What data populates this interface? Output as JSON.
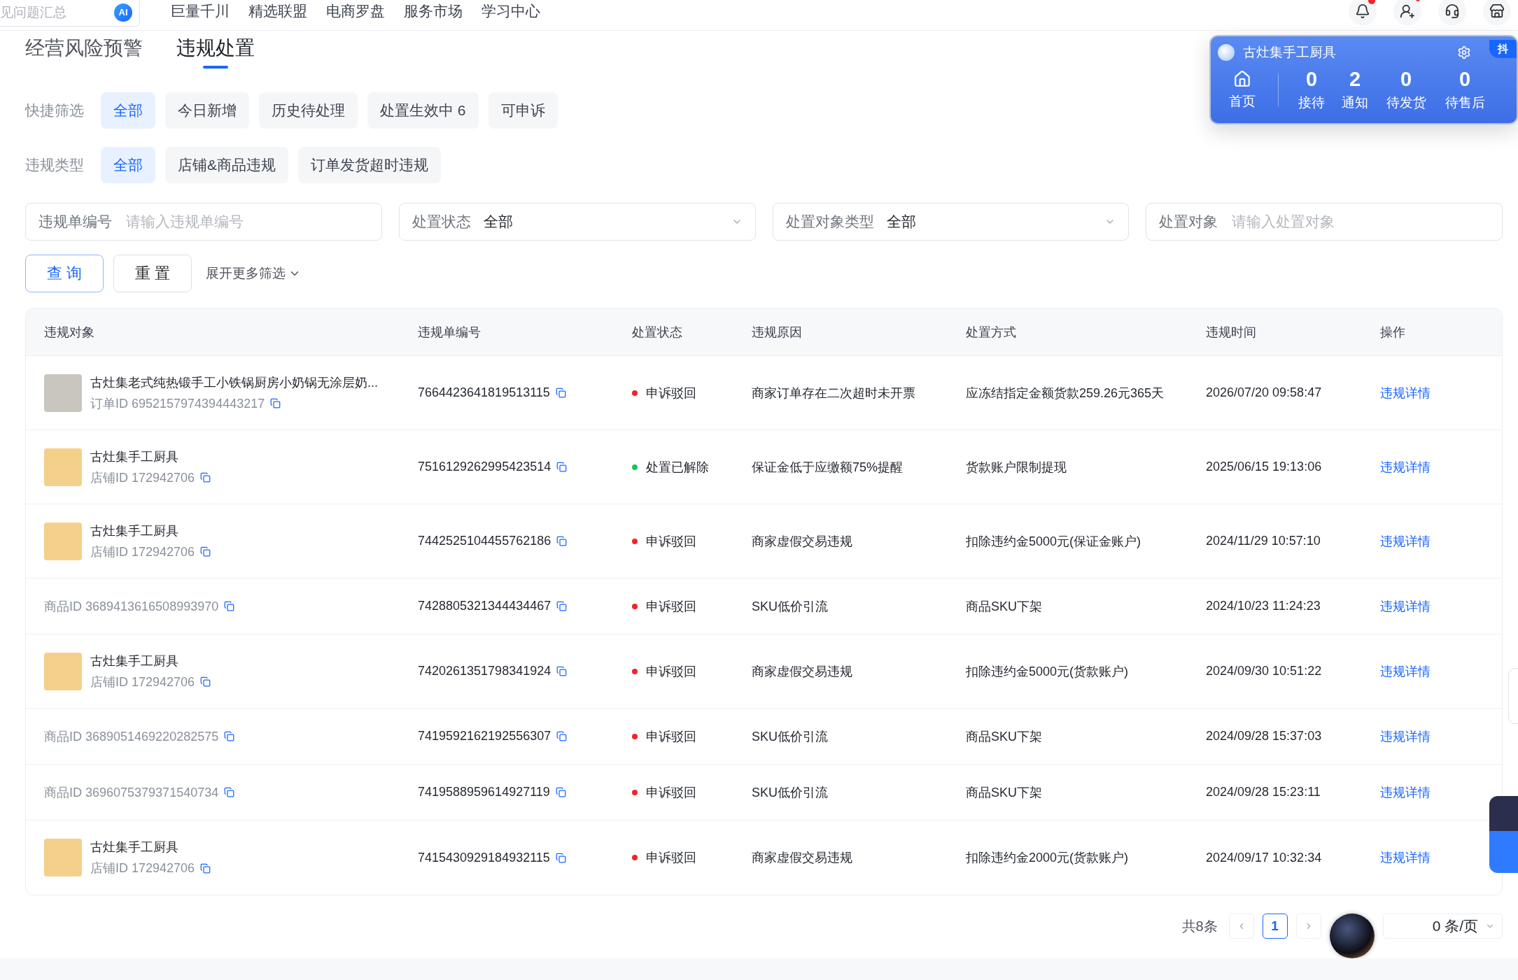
{
  "top_bar": {
    "search_placeholder": "见问题汇总",
    "ai_badge": "AI",
    "nav_links": [
      "巨量千川",
      "精选联盟",
      "电商罗盘",
      "服务市场",
      "学习中心"
    ]
  },
  "tabs": [
    {
      "label": "经营风险预警",
      "selected": false
    },
    {
      "label": "违规处置",
      "selected": true
    }
  ],
  "quick_filters": {
    "label": "快捷筛选",
    "options": [
      {
        "label": "全部",
        "selected": true
      },
      {
        "label": "今日新增",
        "selected": false
      },
      {
        "label": "历史待处理",
        "selected": false
      },
      {
        "label": "处置生效中 6",
        "selected": false
      },
      {
        "label": "可申诉",
        "selected": false
      }
    ]
  },
  "violation_types": {
    "label": "违规类型",
    "options": [
      {
        "label": "全部",
        "selected": true
      },
      {
        "label": "店铺&商品违规",
        "selected": false
      },
      {
        "label": "订单发货超时违规",
        "selected": false
      }
    ]
  },
  "fields": [
    {
      "kind": "input",
      "label": "违规单编号",
      "placeholder": "请输入违规单编号"
    },
    {
      "kind": "select",
      "label": "处置状态",
      "value": "全部"
    },
    {
      "kind": "select",
      "label": "处置对象类型",
      "value": "全部"
    },
    {
      "kind": "input",
      "label": "处置对象",
      "placeholder": "请输入处置对象"
    }
  ],
  "actions": {
    "query": "查 询",
    "reset": "重 置",
    "expand": "展开更多筛选"
  },
  "table": {
    "columns": [
      "违规对象",
      "违规单编号",
      "处置状态",
      "违规原因",
      "处置方式",
      "违规时间",
      "操作"
    ],
    "rows": [
      {
        "target": {
          "kind": "order",
          "title": "古灶集老式纯热锻手工小铁锅厨房小奶锅无涂层奶...",
          "id": "订单ID 6952157974394443217"
        },
        "number": "7664423641819513115",
        "status": {
          "text": "申诉驳回",
          "color": "#f5222d"
        },
        "reason": "商家订单存在二次超时未开票",
        "method": "应冻结指定金额货款259.26元365天",
        "time": "2026/07/20 09:58:47",
        "action": "违规详情"
      },
      {
        "target": {
          "kind": "shop",
          "title": "古灶集手工厨具",
          "id": "店铺ID 172942706"
        },
        "number": "7516129262995423514",
        "status": {
          "text": "处置已解除",
          "color": "#1bc45a"
        },
        "reason": "保证金低于应缴额75%提醒",
        "method": "货款账户限制提现",
        "time": "2025/06/15 19:13:06",
        "action": "违规详情"
      },
      {
        "target": {
          "kind": "shop",
          "title": "古灶集手工厨具",
          "id": "店铺ID 172942706"
        },
        "number": "7442525104455762186",
        "status": {
          "text": "申诉驳回",
          "color": "#f5222d"
        },
        "reason": "商家虚假交易违规",
        "method": "扣除违约金5000元(保证金账户)",
        "time": "2024/11/29 10:57:10",
        "action": "违规详情"
      },
      {
        "target": {
          "kind": "product",
          "id": "商品ID 3689413616508993970"
        },
        "number": "7428805321344434467",
        "status": {
          "text": "申诉驳回",
          "color": "#f5222d"
        },
        "reason": "SKU低价引流",
        "method": "商品SKU下架",
        "time": "2024/10/23 11:24:23",
        "action": "违规详情"
      },
      {
        "target": {
          "kind": "shop",
          "title": "古灶集手工厨具",
          "id": "店铺ID 172942706"
        },
        "number": "7420261351798341924",
        "status": {
          "text": "申诉驳回",
          "color": "#f5222d"
        },
        "reason": "商家虚假交易违规",
        "method": "扣除违约金5000元(货款账户)",
        "time": "2024/09/30 10:51:22",
        "action": "违规详情"
      },
      {
        "target": {
          "kind": "product",
          "id": "商品ID 3689051469220282575"
        },
        "number": "7419592162192556307",
        "status": {
          "text": "申诉驳回",
          "color": "#f5222d"
        },
        "reason": "SKU低价引流",
        "method": "商品SKU下架",
        "time": "2024/09/28 15:37:03",
        "action": "违规详情"
      },
      {
        "target": {
          "kind": "product",
          "id": "商品ID 3696075379371540734"
        },
        "number": "7419588959614927119",
        "status": {
          "text": "申诉驳回",
          "color": "#f5222d"
        },
        "reason": "SKU低价引流",
        "method": "商品SKU下架",
        "time": "2024/09/28 15:23:11",
        "action": "违规详情"
      },
      {
        "target": {
          "kind": "shop",
          "title": "古灶集手工厨具",
          "id": "店铺ID 172942706"
        },
        "number": "7415430929184932115",
        "status": {
          "text": "申诉驳回",
          "color": "#f5222d"
        },
        "reason": "商家虚假交易违规",
        "method": "扣除违约金2000元(货款账户)",
        "time": "2024/09/17 10:32:34",
        "action": "违规详情"
      }
    ]
  },
  "pagination": {
    "total": "共8条",
    "pages": [
      {
        "label": "1",
        "selected": true
      }
    ],
    "page_size": "0 条/页"
  },
  "shop_panel": {
    "name": "古灶集手工厨具",
    "brand": "抖",
    "home": "首页",
    "stats": [
      {
        "value": "0",
        "label": "接待"
      },
      {
        "value": "2",
        "label": "通知"
      },
      {
        "value": "0",
        "label": "待发货"
      },
      {
        "value": "0",
        "label": "待售后"
      }
    ]
  }
}
